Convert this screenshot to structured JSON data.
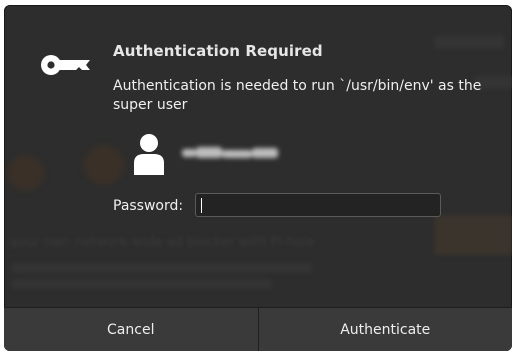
{
  "dialog": {
    "title": "Authentication Required",
    "message": "Authentication is needed to run `/usr/bin/env' as the super user",
    "key_icon": "key-icon",
    "avatar_icon": "user-avatar-icon",
    "password_label": "Password:",
    "password_value": "",
    "cancel_label": "Cancel",
    "authenticate_label": "Authenticate"
  },
  "background": {
    "headline": "-your own network-wide ad blocker with Pi-hole"
  },
  "colors": {
    "dialog_bg": "#2d2d2d",
    "button_bar_bg": "#3a3a3a",
    "text": "#f0f0f0",
    "input_bg": "#232323"
  }
}
